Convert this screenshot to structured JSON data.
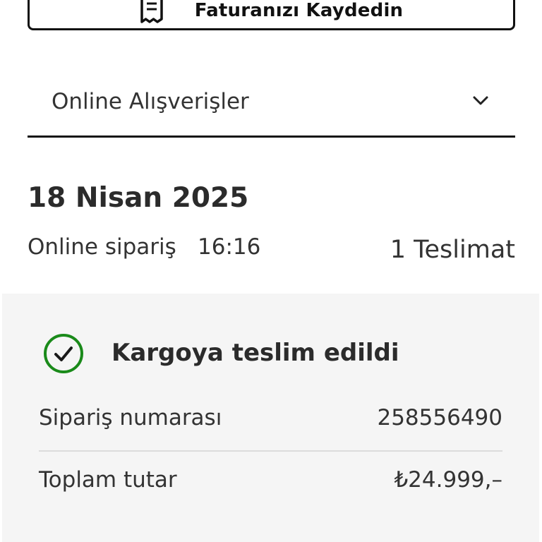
{
  "invoice_button": {
    "label": "Faturanızı Kaydedin",
    "icon": "receipt-icon"
  },
  "filter": {
    "selected": "Online Alışverişler",
    "icon": "chevron-down-icon"
  },
  "order": {
    "date": "18 Nisan 2025",
    "type": "Online sipariş",
    "time": "16:16",
    "deliveries": "1 Teslimat"
  },
  "delivery_card": {
    "status": "Kargoya teslim edildi",
    "status_icon": "check-circle-icon",
    "status_color": "#1a8a1a",
    "order_number_label": "Sipariş numarası",
    "order_number": "258556490",
    "total_label": "Toplam tutar",
    "total": "₺24.999,–"
  }
}
